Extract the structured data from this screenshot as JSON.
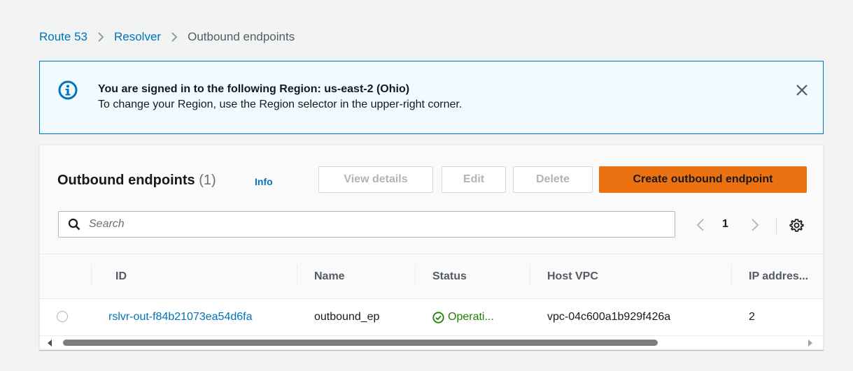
{
  "breadcrumb": {
    "items": [
      "Route 53",
      "Resolver"
    ],
    "current": "Outbound endpoints"
  },
  "flash": {
    "title": "You are signed in to the following Region: us-east-2 (Ohio)",
    "body": "To change your Region, use the Region selector in the upper-right corner."
  },
  "panel": {
    "title": "Outbound endpoints",
    "count": "(1)",
    "info": "Info",
    "buttons": {
      "view_details": "View details",
      "edit": "Edit",
      "delete": "Delete",
      "create": "Create outbound endpoint"
    },
    "search_placeholder": "Search",
    "page": "1"
  },
  "table": {
    "columns": [
      "ID",
      "Name",
      "Status",
      "Host VPC",
      "IP addres..."
    ],
    "rows": [
      {
        "id": "rslvr-out-f84b21073ea54d6fa",
        "name": "outbound_ep",
        "status": "Operati...",
        "host_vpc": "vpc-04c600a1b929f426a",
        "ip_addresses": "2"
      }
    ]
  },
  "colors": {
    "link": "#0073bb",
    "primary": "#ec7211",
    "success": "#1d8102",
    "info_border": "#0073bb",
    "info_bg": "#f1faff"
  },
  "icons": [
    "chevron-right-icon",
    "info-icon",
    "close-icon",
    "search-icon",
    "chevron-left-icon",
    "gear-icon",
    "status-success-icon",
    "caret-left-icon",
    "caret-right-icon"
  ]
}
